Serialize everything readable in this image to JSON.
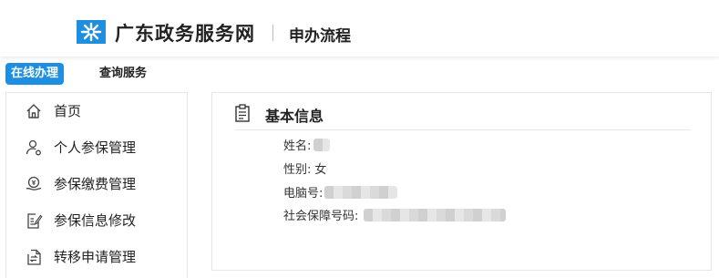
{
  "header": {
    "brand": "广东政务服务网",
    "subtitle": "申办流程",
    "logo_icon": "gd-gov-logo-icon",
    "brand_color": "#1e8fe0"
  },
  "tabs": [
    {
      "label": "在线办理",
      "active": true
    },
    {
      "label": "查询服务",
      "active": false
    }
  ],
  "sidebar": {
    "items": [
      {
        "label": "首页",
        "icon": "home-icon"
      },
      {
        "label": "个人参保管理",
        "icon": "person-gear-icon"
      },
      {
        "label": "参保缴费管理",
        "icon": "payment-icon"
      },
      {
        "label": "参保信息修改",
        "icon": "edit-document-icon"
      },
      {
        "label": "转移申请管理",
        "icon": "transfer-document-icon"
      }
    ]
  },
  "panel": {
    "title": "基本信息",
    "icon": "clipboard-icon",
    "fields": [
      {
        "label": "姓名:",
        "value": ""
      },
      {
        "label": "性别:",
        "value": "女"
      },
      {
        "label": "电脑号:",
        "value": ""
      },
      {
        "label": "社会保障号码:",
        "value": ""
      }
    ]
  }
}
